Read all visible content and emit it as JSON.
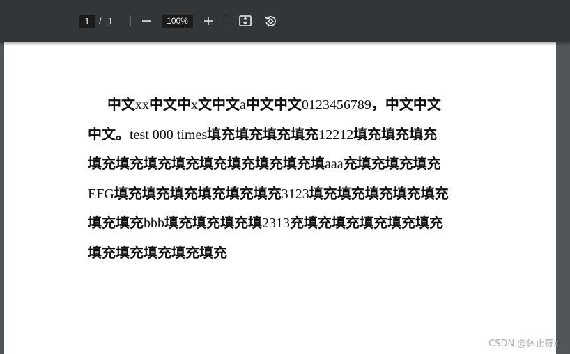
{
  "toolbar": {
    "current_page": "1",
    "page_separator": "/",
    "total_pages": "1",
    "zoom": "100%",
    "icons": [
      "minus-icon",
      "plus-icon",
      "fit-page-icon",
      "rotate-icon"
    ]
  },
  "document": {
    "lines": [
      [
        {
          "t": "中文",
          "b": true
        },
        {
          "t": "xx",
          "b": false
        },
        {
          "t": "中文中",
          "b": true
        },
        {
          "t": "x",
          "b": false
        },
        {
          "t": "文中文",
          "b": true
        },
        {
          "t": "a",
          "b": false
        },
        {
          "t": "中文中文",
          "b": true
        },
        {
          "t": "0123456789",
          "b": false
        },
        {
          "t": "，中文中文",
          "b": true
        }
      ],
      [
        {
          "t": "中文。",
          "b": true
        },
        {
          "t": "test 000 times",
          "b": false
        },
        {
          "t": "填充填充填充填充",
          "b": true
        },
        {
          "t": "12212",
          "b": false
        },
        {
          "t": "填充填充填充",
          "b": true
        }
      ],
      [
        {
          "t": "填充填充填充填充填充填充填充填充填",
          "b": true
        },
        {
          "t": "aaa",
          "b": false
        },
        {
          "t": "充填充填充填充",
          "b": true
        }
      ],
      [
        {
          "t": "EFG",
          "b": false
        },
        {
          "t": "填充填充填充填充填充填充",
          "b": true
        },
        {
          "t": "3123",
          "b": false
        },
        {
          "t": "填充填充填充填充填充",
          "b": true
        }
      ],
      [
        {
          "t": "填充填充",
          "b": true
        },
        {
          "t": "bbb",
          "b": false
        },
        {
          "t": "填充填充填充填",
          "b": true
        },
        {
          "t": "2313",
          "b": false
        },
        {
          "t": "充填充填充填充填充填充",
          "b": true
        }
      ],
      [
        {
          "t": "填充填充填充填充填充",
          "b": true
        }
      ]
    ]
  },
  "watermark": "CSDN @休止符x",
  "colors": {
    "toolbar_bg": "#323639",
    "viewer_bg": "#525659",
    "page_bg": "#ffffff",
    "field_bg": "#191b1c"
  }
}
